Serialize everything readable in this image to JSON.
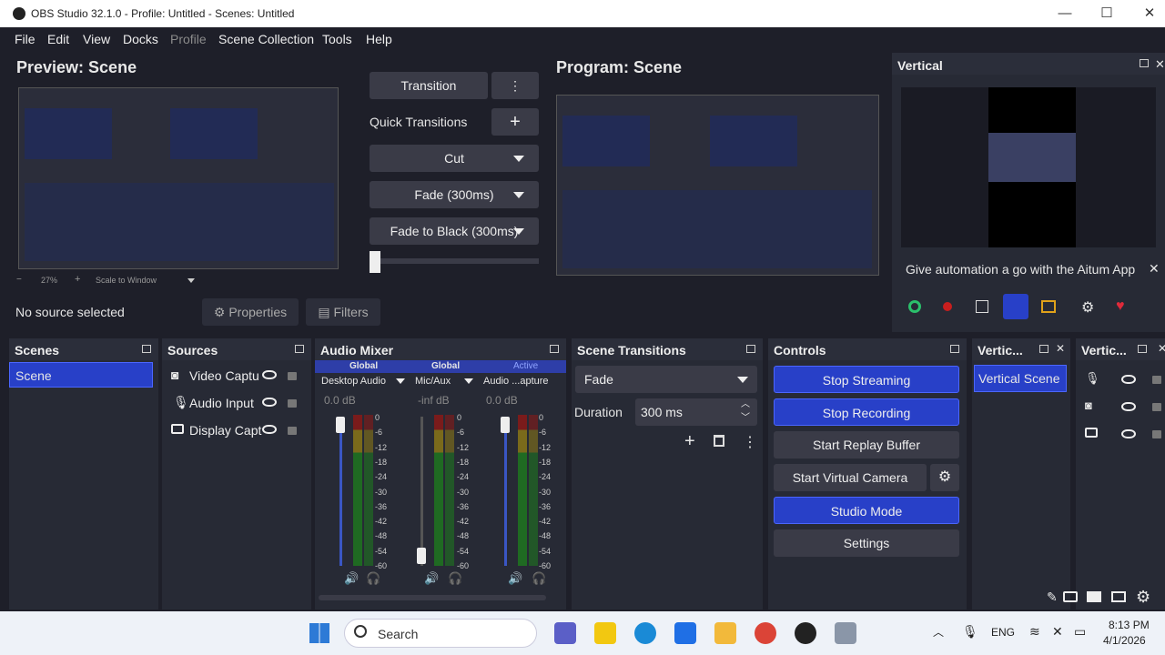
{
  "window": {
    "title": "OBS Studio 32.1.0 - Profile: Untitled - Scenes: Untitled",
    "min": "—",
    "max": "☐",
    "close": "✕"
  },
  "menu": [
    "File",
    "Edit",
    "View",
    "Docks",
    "Profile",
    "Scene Collection",
    "Tools",
    "Help"
  ],
  "preview": {
    "title": "Preview: Scene",
    "zoom": "27%",
    "scale_label": "Scale to Window"
  },
  "program": {
    "title": "Program: Scene"
  },
  "transitions": {
    "transition_label": "Transition",
    "quick_label": "Quick Transitions",
    "cut": "Cut",
    "fade": "Fade (300ms)",
    "fade_black": "Fade to Black (300ms)"
  },
  "source_bar": {
    "no_source": "No source selected",
    "properties": "Properties",
    "filters": "Filters"
  },
  "vertical": {
    "title": "Vertical",
    "promo": "Give automation a go with the Aitum App"
  },
  "scenes": {
    "title": "Scenes",
    "items": [
      "Scene"
    ]
  },
  "sources": {
    "title": "Sources",
    "items": [
      "Video Captu",
      "Audio Input",
      "Display Capt"
    ]
  },
  "mixer": {
    "title": "Audio Mixer",
    "channels": [
      {
        "tag": "Global",
        "name": "Desktop Audio",
        "db": "0.0 dB"
      },
      {
        "tag": "Global",
        "name": "Mic/Aux",
        "db": "-inf dB"
      },
      {
        "tag": "Active",
        "name": "Audio ...apture",
        "db": "0.0 dB"
      }
    ],
    "scale": [
      "0",
      "-6",
      "-12",
      "-18",
      "-24",
      "-30",
      "-36",
      "-42",
      "-48",
      "-54",
      "-60"
    ]
  },
  "scene_transitions": {
    "title": "Scene Transitions",
    "selected": "Fade",
    "duration_label": "Duration",
    "duration_value": "300 ms"
  },
  "controls": {
    "title": "Controls",
    "stop_streaming": "Stop Streaming",
    "stop_recording": "Stop Recording",
    "replay": "Start Replay Buffer",
    "virtual_cam": "Start Virtual Camera",
    "studio_mode": "Studio Mode",
    "settings": "Settings"
  },
  "vert_scenes": {
    "title": "Vertic...",
    "item": "Vertical Scene"
  },
  "vert_sources": {
    "title": "Vertic..."
  },
  "taskbar": {
    "search": "Search",
    "lang": "ENG",
    "time": "8:13 PM",
    "date": "4/1/2026"
  },
  "colors": {
    "accent": "#2840c8",
    "bg": "#1e1f29",
    "dock": "#272a35"
  }
}
